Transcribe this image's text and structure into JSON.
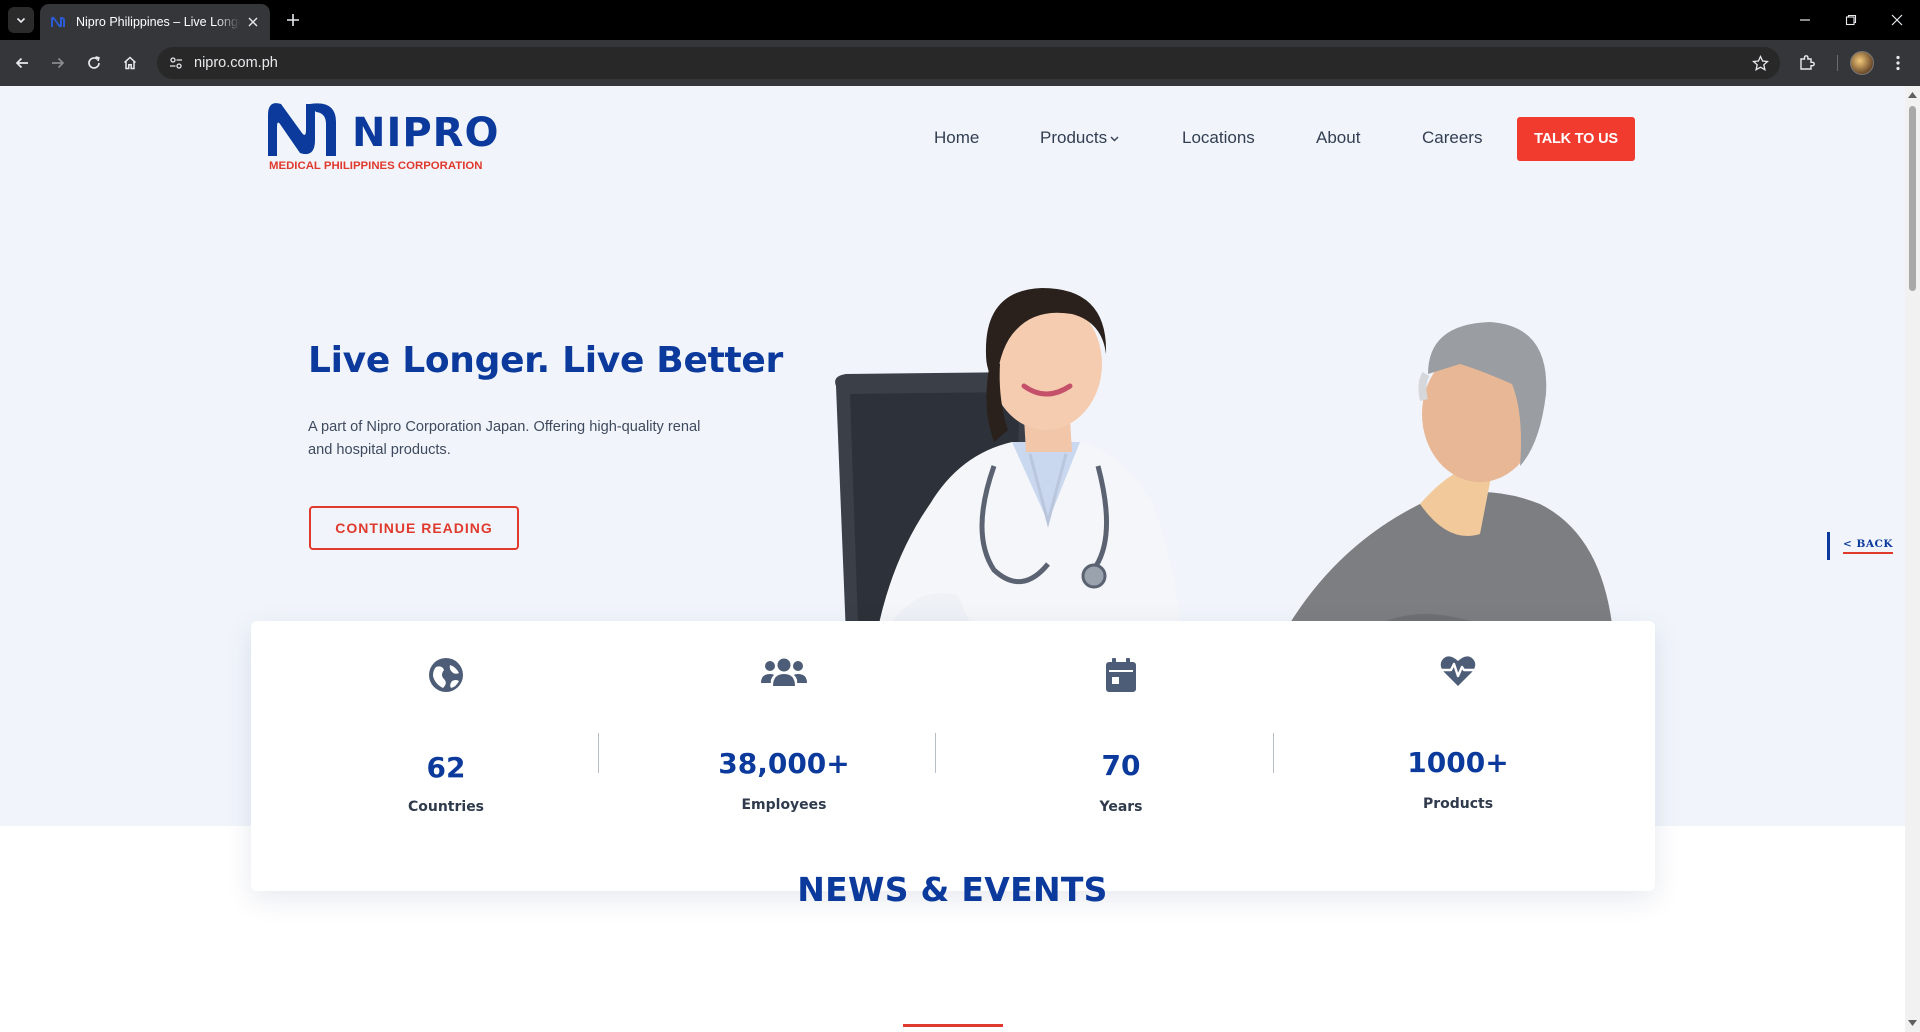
{
  "browser": {
    "tab_title": "Nipro Philippines – Live Longer. Live Better",
    "url": "nipro.com.ph"
  },
  "logo": {
    "word": "NIPRO",
    "subtitle": "MEDICAL PHILIPPINES CORPORATION"
  },
  "nav": {
    "items": [
      "Home",
      "Products",
      "Locations",
      "About",
      "Careers"
    ],
    "cta": "TALK TO US"
  },
  "hero": {
    "title": "Live Longer. Live Better",
    "text": "A part of Nipro Corporation Japan. Offering high-quality renal and hospital products.",
    "button": "CONTINUE READING"
  },
  "back_link": "<  BACK",
  "stats": [
    {
      "icon": "globe-icon",
      "value": "62",
      "label": "Countries"
    },
    {
      "icon": "users-icon",
      "value": "38,000+",
      "label": "Employees"
    },
    {
      "icon": "calendar-icon",
      "value": "70",
      "label": "Years"
    },
    {
      "icon": "heart-pulse-icon",
      "value": "1000+",
      "label": "Products"
    }
  ],
  "news": {
    "title": "NEWS & EVENTS"
  },
  "colors": {
    "brand_blue": "#0b3a9c",
    "brand_red": "#e0392d",
    "cta_red": "#f23b2f",
    "page_bg": "#f1f5fb"
  }
}
